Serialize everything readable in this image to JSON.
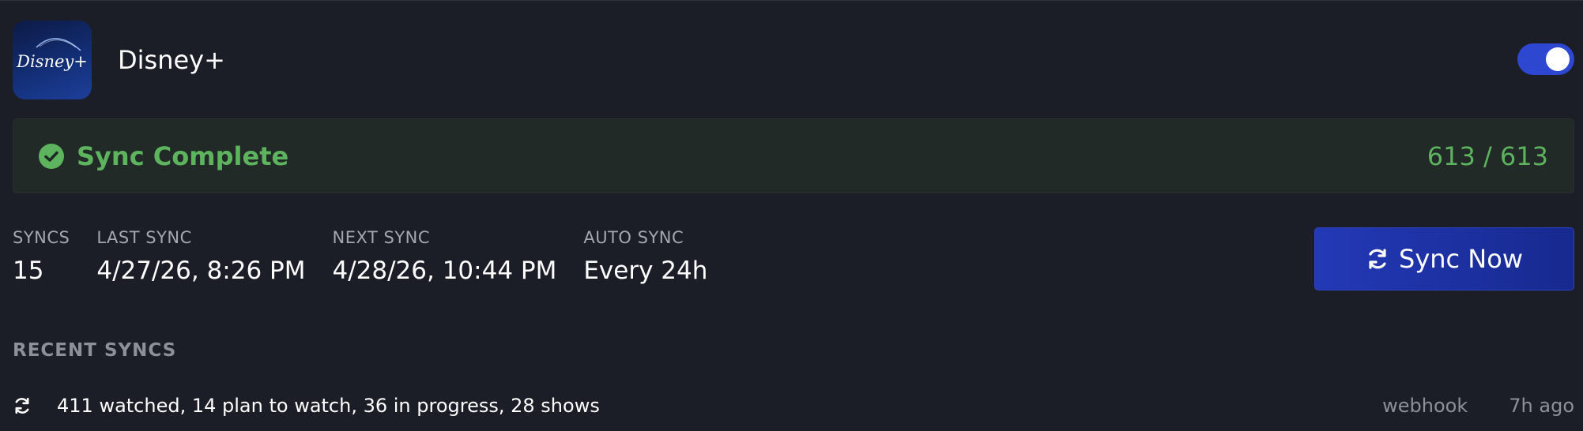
{
  "service": {
    "name": "Disney+",
    "logo_text": "Disney+",
    "enabled": true
  },
  "status": {
    "title": "Sync Complete",
    "count": "613 / 613",
    "color": "#5db35e"
  },
  "stats": [
    {
      "label": "SYNCS",
      "value": "15"
    },
    {
      "label": "LAST SYNC",
      "value": "4/27/26, 8:26 PM"
    },
    {
      "label": "NEXT SYNC",
      "value": "4/28/26, 10:44 PM"
    },
    {
      "label": "AUTO SYNC",
      "value": "Every 24h"
    }
  ],
  "sync_button": {
    "label": "Sync Now",
    "icon": "refresh-icon"
  },
  "recent": {
    "title": "RECENT SYNCS",
    "items": [
      {
        "summary": "411 watched, 14 plan to watch, 36 in progress, 28 shows",
        "source": "webhook",
        "time": "7h ago",
        "icon": "refresh-icon"
      }
    ]
  },
  "colors": {
    "accent": "#2e47d0",
    "background": "#1b1e26",
    "success": "#5db35e"
  }
}
